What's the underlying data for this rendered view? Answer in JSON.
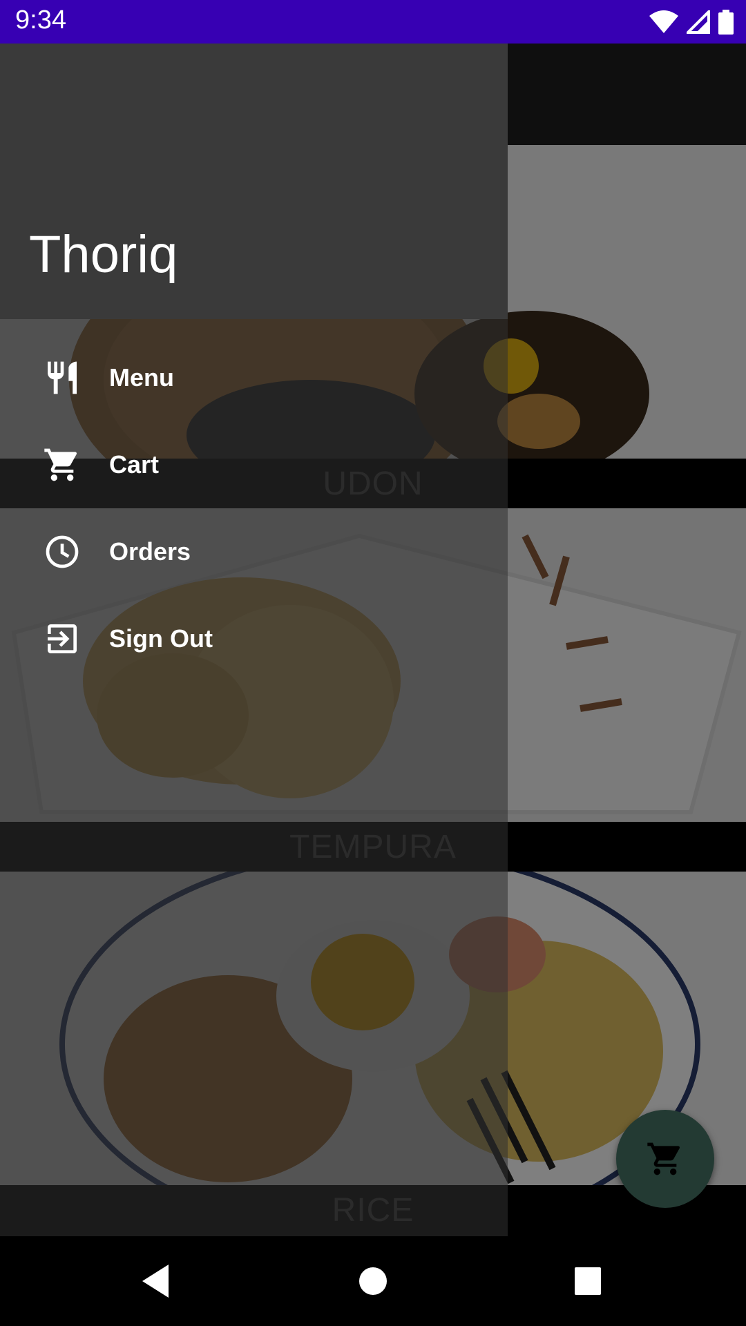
{
  "status_bar": {
    "time": "9:34"
  },
  "colors": {
    "status_bar": "#3700b3",
    "fab": "#233a33",
    "drawer_header": "#3a3a3a"
  },
  "drawer": {
    "user_name": "Thoriq",
    "items": [
      {
        "label": "Menu",
        "icon": "restaurant-icon"
      },
      {
        "label": "Cart",
        "icon": "cart-icon"
      },
      {
        "label": "Orders",
        "icon": "clock-icon"
      },
      {
        "label": "Sign Out",
        "icon": "exit-icon"
      }
    ]
  },
  "categories": [
    {
      "label": "UDON"
    },
    {
      "label": "TEMPURA"
    },
    {
      "label": "RICE"
    }
  ],
  "fab": {
    "icon": "cart-icon"
  },
  "nav_bar": {
    "icons": [
      "back-icon",
      "home-icon",
      "recents-icon"
    ]
  }
}
